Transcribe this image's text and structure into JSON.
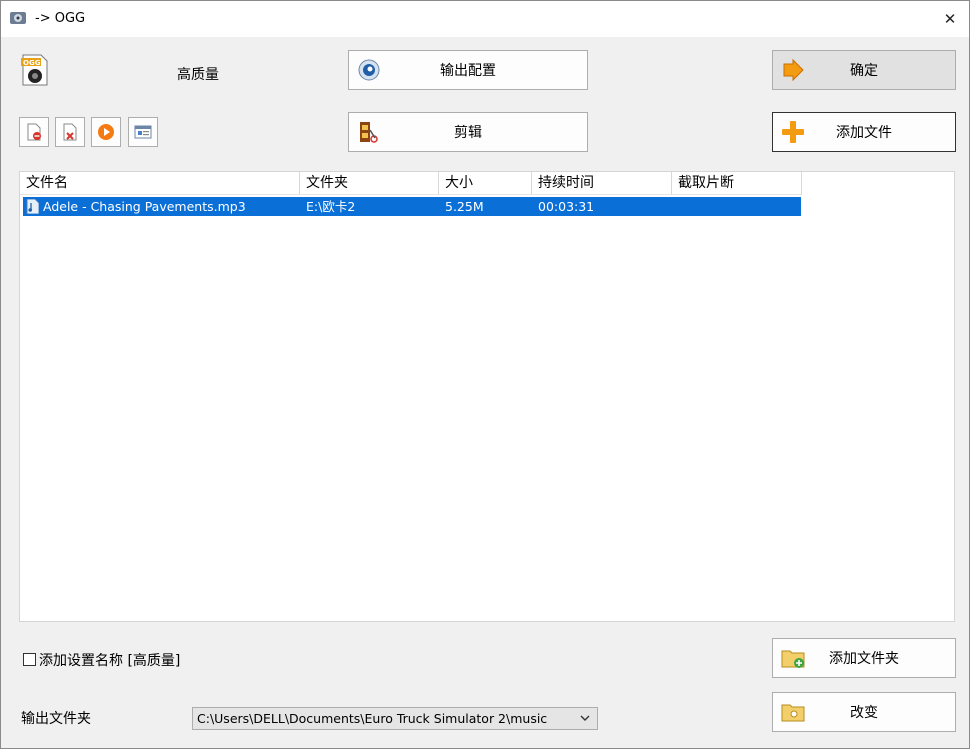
{
  "window": {
    "title": "-> OGG",
    "close_glyph": "✕"
  },
  "profile": {
    "label": "高质量",
    "icon": "ogg-file-icon"
  },
  "buttons": {
    "output_config": "输出配置",
    "edit": "剪辑",
    "ok": "确定",
    "add_file": "添加文件",
    "add_folder": "添加文件夹",
    "change": "改变"
  },
  "toolbar": [
    "remove-file-icon",
    "delete-icon",
    "play-icon",
    "properties-icon"
  ],
  "file_list": {
    "columns": [
      "文件名",
      "文件夹",
      "大小",
      "持续时间",
      "截取片断"
    ],
    "rows": [
      {
        "name": "Adele - Chasing Pavements.mp3",
        "folder": "E:\\欧卡2",
        "size": "5.25M",
        "duration": "00:03:31",
        "clip": ""
      }
    ]
  },
  "options": {
    "add_setting_name": "添加设置名称 [高质量]",
    "checked": false
  },
  "output": {
    "label": "输出文件夹",
    "path": "C:\\Users\\DELL\\Documents\\Euro Truck Simulator 2\\music"
  },
  "colors": {
    "selection": "#0a6fd6",
    "accent_orange": "#f39c12"
  }
}
